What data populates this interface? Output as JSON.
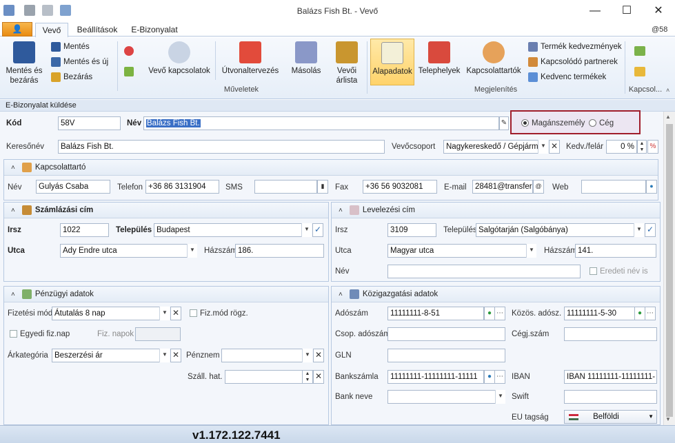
{
  "window": {
    "title": "Balázs Fish Bt. - Vevő",
    "minimize": "—",
    "maximize": "☐",
    "close": "✕",
    "user_tag": "@58"
  },
  "tabs": {
    "active": "Vevő",
    "settings": "Beállítások",
    "einvoice": "E-Bizonyalat"
  },
  "ribbon": {
    "save_close": [
      "Mentés és",
      "bezárás"
    ],
    "save": "Mentés",
    "save_new": "Mentés és új",
    "close": "Bezárás",
    "contacts": "Vevő kapcsolatok",
    "route": "Útvonaltervezés",
    "copy": "Másolás",
    "prices": [
      "Vevői",
      "árlista"
    ],
    "group_ops": "Műveletek",
    "basic": "Alapadatok",
    "sites": "Telephelyek",
    "contact_persons": "Kapcsolattartók",
    "discounts": "Termék kedvezmények",
    "partners": "Kapcsolódó partnerek",
    "favorites": "Kedvenc termékek",
    "group_view": "Megjelenítés",
    "group_kapcs": "Kapcsol..."
  },
  "subbar": "E-Bizonyalat küldése",
  "header": {
    "kod_label": "Kód",
    "kod": "58V",
    "nev_label": "Név",
    "nev": "Balázs Fish Bt.",
    "radio_person": "Magánszemély",
    "radio_company": "Cég",
    "search_label": "Keresőnév",
    "search": "Balázs Fish Bt.",
    "group_label": "Vevőcsoport",
    "group": "Nagykereskedő / Gépjármű",
    "discount_label": "Kedv./felár",
    "discount": "0 %"
  },
  "contact": {
    "title": "Kapcsolattartó",
    "nev_label": "Név",
    "nev": "Gulyás Csaba",
    "tel_label": "Telefon",
    "tel": "+36 86 3131904",
    "sms_label": "SMS",
    "sms": "",
    "fax_label": "Fax",
    "fax": "+36 56 9032081",
    "email_label": "E-mail",
    "email": "28481@transfer.",
    "web_label": "Web",
    "web": ""
  },
  "billing": {
    "title": "Számlázási cím",
    "irsz_label": "Irsz",
    "irsz": "1022",
    "city_label": "Település",
    "city": "Budapest",
    "street_label": "Utca",
    "street": "Ady Endre utca",
    "house_label": "Házszám",
    "house": "186."
  },
  "mailing": {
    "title": "Levelezési cím",
    "irsz_label": "Irsz",
    "irsz": "3109",
    "city_label": "Település",
    "city": "Salgótarján (Salgóbánya)",
    "street_label": "Utca",
    "street": "Magyar utca",
    "house_label": "Házszám",
    "house": "141.",
    "name_label": "Név",
    "name": "",
    "orig_label": "Eredeti név is"
  },
  "finance": {
    "title": "Pénzügyi adatok",
    "pay_label": "Fizetési mód",
    "pay": "Átutalás 8 nap",
    "pay_fix_label": "Fiz.mód rögz.",
    "custom_label": "Egyedi fiz.nap",
    "days_label": "Fiz. napok",
    "price_label": "Árkategória",
    "price": "Beszerzési ár",
    "currency_label": "Pénznem",
    "currency": "",
    "delivery_label": "Száll. hat.",
    "delivery": ""
  },
  "public": {
    "title": "Közigazgatási adatok",
    "tax_label": "Adószám",
    "tax": "11111111-8-51",
    "comtax_label": "Közös. adósz.",
    "comtax": "11111111-5-30",
    "grouptax_label": "Csop. adószám",
    "grouptax": "",
    "reg_label": "Cégj.szám",
    "reg": "",
    "gln_label": "GLN",
    "gln": "",
    "bank_label": "Bankszámla",
    "bank": "11111111-11111111-11111",
    "iban_label": "IBAN",
    "iban": "IBAN 11111111-11111111-",
    "bankname_label": "Bank neve",
    "bankname": "",
    "swift_label": "Swift",
    "swift": "",
    "eu_label": "EU tagság",
    "eu": "Belföldi"
  },
  "status": {
    "version": "v1.172.122.7441"
  }
}
